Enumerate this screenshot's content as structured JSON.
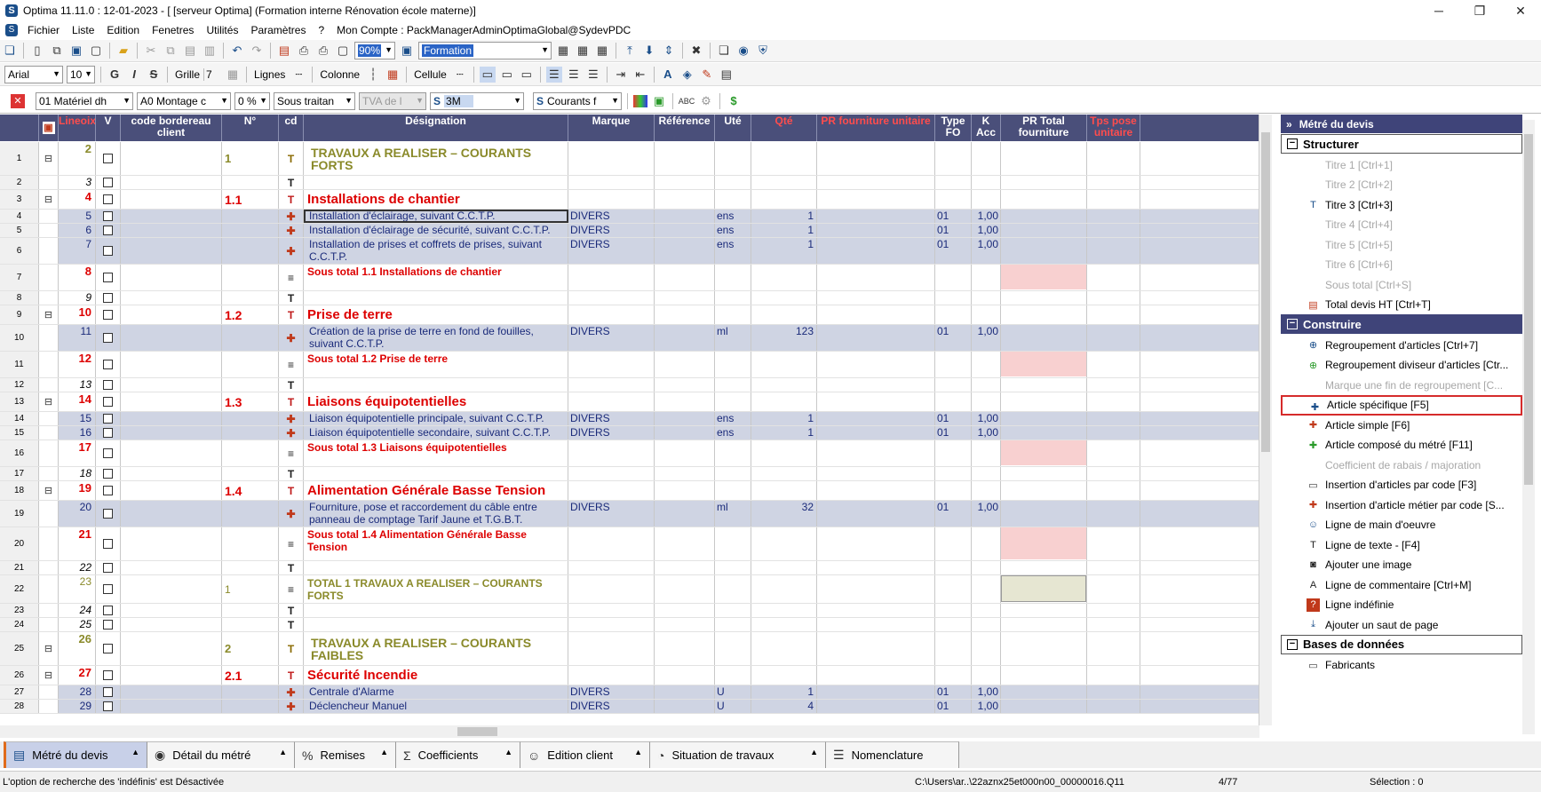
{
  "title": "Optima 11.11.0 : 12-01-2023 - [ [serveur Optima] (Formation interne Rénovation école materne)]",
  "menu": [
    "Fichier",
    "Liste",
    "Edition",
    "Fenetres",
    "Utilités",
    "Paramètres",
    "?",
    "Mon Compte : PackManagerAdminOptimaGlobal@SydevPDC"
  ],
  "toolbar1": {
    "zoom": "90%",
    "style": "Formation"
  },
  "toolbar2": {
    "font": "Arial",
    "size": "10",
    "grille": "Grille",
    "grille_val": "7",
    "lignes": "Lignes",
    "colonne": "Colonne",
    "cellule": "Cellule"
  },
  "toolbar3": {
    "lot": "01  Matériel dh",
    "montage": "A0  Montage c",
    "pct": "0 %",
    "sous": "Sous traitan",
    "tva": "TVA de l",
    "fab": "3M",
    "courants": "Courants f"
  },
  "columns": [
    "Lineoix",
    "V",
    "code bordereau client",
    "N°",
    "cd",
    "Désignation",
    "Marque",
    "Référence",
    "Uté",
    "Qté",
    "PR fourniture unitaire",
    "Type FO",
    "K Acc",
    "PR Total fourniture",
    "Tps pose unitaire"
  ],
  "rows": [
    {
      "n": "1",
      "lin": "2",
      "num": "1",
      "des": "TRAVAUX A REALISER – COURANTS FORTS",
      "kind": "t1",
      "exp": "⊟",
      "cd": "T1"
    },
    {
      "n": "2",
      "lin": "3",
      "kind": "txt",
      "cd": "T"
    },
    {
      "n": "3",
      "lin": "4",
      "num": "1.1",
      "des": "Installations de chantier",
      "kind": "t2",
      "exp": "⊟",
      "cd": "T2"
    },
    {
      "n": "4",
      "lin": "5",
      "des": "Installation d'éclairage, suivant C.C.T.P.",
      "marque": "DIVERS",
      "ute": "ens",
      "qte": "1",
      "type": "01",
      "k": "1,00",
      "kind": "art",
      "cur": true,
      "cd": "A"
    },
    {
      "n": "5",
      "lin": "6",
      "des": "Installation d'éclairage de sécurité, suivant C.C.T.P.",
      "marque": "DIVERS",
      "ute": "ens",
      "qte": "1",
      "type": "01",
      "k": "1,00",
      "kind": "art",
      "cd": "A"
    },
    {
      "n": "6",
      "lin": "7",
      "des": "Installation de prises et coffrets de prises, suivant C.C.T.P.",
      "marque": "DIVERS",
      "ute": "ens",
      "qte": "1",
      "type": "01",
      "k": "1,00",
      "kind": "art",
      "cd": "A"
    },
    {
      "n": "7",
      "lin": "8",
      "des": "Sous total 1.1 Installations de chantier",
      "kind": "st",
      "cd": "S"
    },
    {
      "n": "8",
      "lin": "9",
      "kind": "txt",
      "cd": "T"
    },
    {
      "n": "9",
      "lin": "10",
      "num": "1.2",
      "des": "Prise de terre",
      "kind": "t2",
      "exp": "⊟",
      "cd": "T2"
    },
    {
      "n": "10",
      "lin": "11",
      "des": "Création de la prise de terre en fond de fouilles, suivant C.C.T.P.",
      "marque": "DIVERS",
      "ute": "ml",
      "qte": "123",
      "type": "01",
      "k": "1,00",
      "kind": "art",
      "cd": "A"
    },
    {
      "n": "11",
      "lin": "12",
      "des": "Sous total 1.2 Prise de terre",
      "kind": "st",
      "cd": "S"
    },
    {
      "n": "12",
      "lin": "13",
      "kind": "txt",
      "cd": "T"
    },
    {
      "n": "13",
      "lin": "14",
      "num": "1.3",
      "des": "Liaisons équipotentielles",
      "kind": "t2",
      "exp": "⊟",
      "cd": "T2"
    },
    {
      "n": "14",
      "lin": "15",
      "des": "Liaison équipotentielle principale, suivant C.C.T.P.",
      "marque": "DIVERS",
      "ute": "ens",
      "qte": "1",
      "type": "01",
      "k": "1,00",
      "kind": "art",
      "cd": "A"
    },
    {
      "n": "15",
      "lin": "16",
      "des": "Liaison équipotentielle secondaire, suivant C.C.T.P.",
      "marque": "DIVERS",
      "ute": "ens",
      "qte": "1",
      "type": "01",
      "k": "1,00",
      "kind": "art",
      "cd": "A"
    },
    {
      "n": "16",
      "lin": "17",
      "des": "Sous total 1.3 Liaisons équipotentielles",
      "kind": "st",
      "cd": "S"
    },
    {
      "n": "17",
      "lin": "18",
      "kind": "txt",
      "cd": "T"
    },
    {
      "n": "18",
      "lin": "19",
      "num": "1.4",
      "des": "Alimentation Générale Basse Tension",
      "kind": "t2",
      "exp": "⊟",
      "cd": "T2"
    },
    {
      "n": "19",
      "lin": "20",
      "des": "Fourniture, pose et raccordement du câble entre panneau de comptage Tarif Jaune et T.G.B.T.",
      "marque": "DIVERS",
      "ute": "ml",
      "qte": "32",
      "type": "01",
      "k": "1,00",
      "kind": "art",
      "cd": "A"
    },
    {
      "n": "20",
      "lin": "21",
      "des": "Sous total 1.4 Alimentation Générale Basse Tension",
      "kind": "st",
      "cd": "S"
    },
    {
      "n": "21",
      "lin": "22",
      "kind": "txt",
      "cd": "T"
    },
    {
      "n": "22",
      "lin": "23",
      "num": "1",
      "des": "TOTAL 1 TRAVAUX A REALISER – COURANTS FORTS",
      "kind": "tot",
      "cd": "S"
    },
    {
      "n": "23",
      "lin": "24",
      "kind": "txt",
      "cd": "T"
    },
    {
      "n": "24",
      "lin": "25",
      "kind": "txt",
      "cd": "T"
    },
    {
      "n": "25",
      "lin": "26",
      "num": "2",
      "des": "TRAVAUX A REALISER – COURANTS FAIBLES",
      "kind": "t1",
      "exp": "⊟",
      "cd": "T1"
    },
    {
      "n": "26",
      "lin": "27",
      "num": "2.1",
      "des": "Sécurité Incendie",
      "kind": "t2",
      "exp": "⊟",
      "cd": "T2"
    },
    {
      "n": "27",
      "lin": "28",
      "des": "Centrale d'Alarme",
      "marque": "DIVERS",
      "ute": "U",
      "qte": "1",
      "type": "01",
      "k": "1,00",
      "kind": "art",
      "cd": "A"
    },
    {
      "n": "28",
      "lin": "29",
      "des": "Déclencheur Manuel",
      "marque": "DIVERS",
      "ute": "U",
      "qte": "4",
      "type": "01",
      "k": "1,00",
      "kind": "art",
      "cd": "A"
    }
  ],
  "panel": {
    "header": "Métré du devis",
    "sections": {
      "structurer": "Structurer",
      "construire": "Construire",
      "bases": "Bases de données"
    },
    "structurer_items": [
      {
        "label": "Titre 1 [Ctrl+1]",
        "dis": true,
        "icon": ""
      },
      {
        "label": "Titre 2 [Ctrl+2]",
        "dis": true,
        "icon": ""
      },
      {
        "label": "Titre 3 [Ctrl+3]",
        "dis": false,
        "icon": "title3-icon"
      },
      {
        "label": "Titre 4 [Ctrl+4]",
        "dis": true,
        "icon": ""
      },
      {
        "label": "Titre 5 [Ctrl+5]",
        "dis": true,
        "icon": ""
      },
      {
        "label": "Titre 6 [Ctrl+6]",
        "dis": true,
        "icon": ""
      },
      {
        "label": "Sous total [Ctrl+S]",
        "dis": true,
        "icon": ""
      },
      {
        "label": "Total devis HT [Ctrl+T]",
        "dis": false,
        "icon": "total-icon"
      }
    ],
    "construire_items": [
      {
        "label": "Regroupement d'articles  [Ctrl+7]",
        "dis": false,
        "icon": "group-icon"
      },
      {
        "label": "Regroupement diviseur d'articles [Ctr...",
        "dis": false,
        "icon": "group-divider-icon"
      },
      {
        "label": "Marque une fin de regroupement   [C...",
        "dis": true,
        "icon": ""
      },
      {
        "label": "Article spécifique [F5]",
        "dis": false,
        "icon": "article-specific-icon",
        "hl": true
      },
      {
        "label": "Article simple [F6]",
        "dis": false,
        "icon": "article-simple-icon"
      },
      {
        "label": "Article composé du métré [F11]",
        "dis": false,
        "icon": "article-compose-icon"
      },
      {
        "label": "Coefficient de rabais / majoration",
        "dis": true,
        "icon": ""
      },
      {
        "label": "Insertion d'articles par code [F3]",
        "dis": false,
        "icon": "code-icon"
      },
      {
        "label": "Insertion d'article métier par code [S...",
        "dis": false,
        "icon": "code-metier-icon"
      },
      {
        "label": "Ligne de main d'oeuvre",
        "dis": false,
        "icon": "worker-icon"
      },
      {
        "label": "Ligne de texte - [F4]",
        "dis": false,
        "icon": "text-icon"
      },
      {
        "label": "Ajouter une image",
        "dis": false,
        "icon": "camera-icon"
      },
      {
        "label": "Ligne de commentaire [Ctrl+M]",
        "dis": false,
        "icon": "comment-icon"
      },
      {
        "label": "Ligne indéfinie",
        "dis": false,
        "icon": "question-icon"
      },
      {
        "label": "Ajouter un saut de page",
        "dis": false,
        "icon": "page-break-icon"
      }
    ],
    "bases_items": [
      {
        "label": "Fabricants",
        "dis": false,
        "icon": "factory-icon"
      }
    ]
  },
  "tabs": [
    "Métré du devis",
    "Détail du métré",
    "Remises",
    "Coefficients",
    "Edition client",
    "Situation de travaux",
    "Nomenclature"
  ],
  "status": {
    "msg": "L'option de recherche des 'indéfinis' est Désactivée",
    "path": "C:\\Users\\ar..\\22aznx25et000n00_00000016.Q11",
    "pos": "4/77",
    "sel": "Sélection : 0"
  }
}
